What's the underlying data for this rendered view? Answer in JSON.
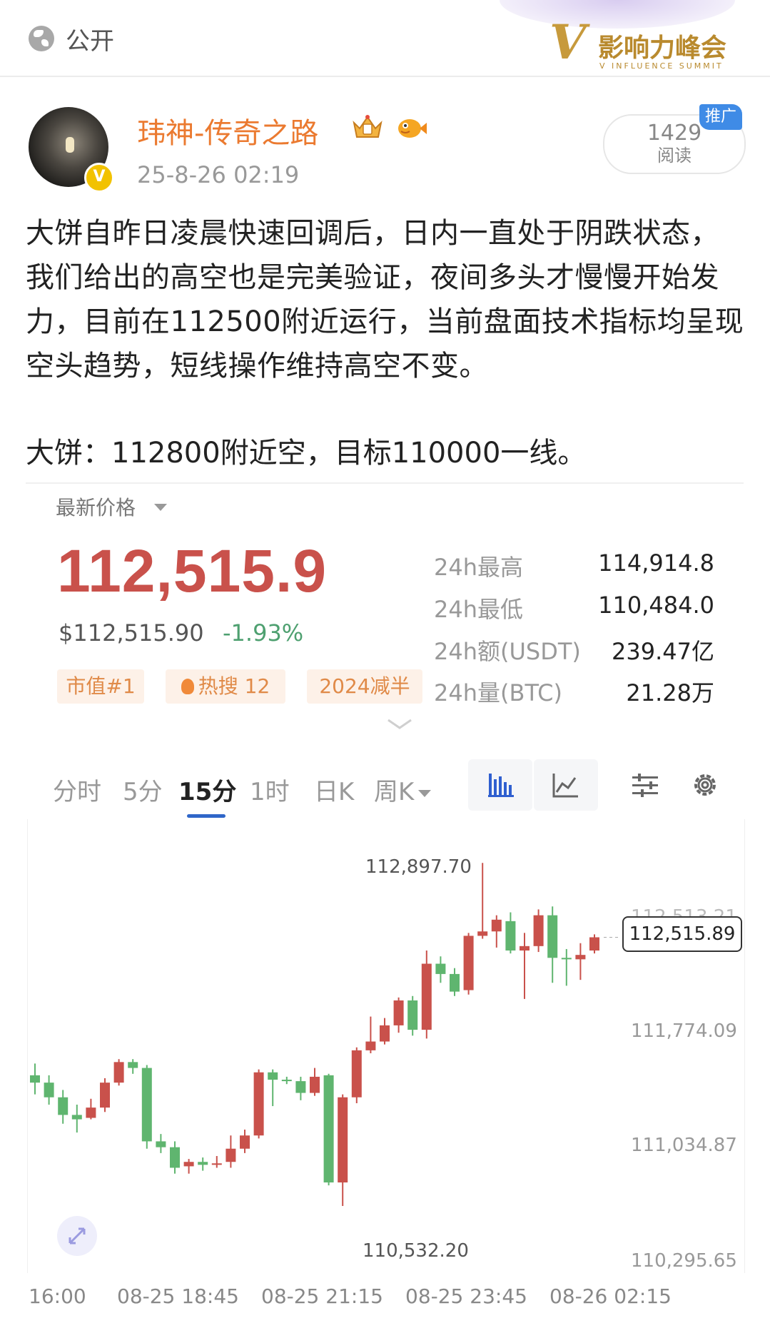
{
  "header": {
    "visibility_label": "公开",
    "brand_logo_text": "影响力峰会",
    "brand_logo_subtext": "V INFLUENCE SUMMIT"
  },
  "post": {
    "author_name": "玮神-传奇之路",
    "timestamp": "25-8-26 02:19",
    "verified_badge": "V",
    "read_count": "1429",
    "read_label": "阅读",
    "promo_tag": "推广",
    "paragraph_1": "大饼自昨日凌晨快速回调后，日内一直处于阴跌状态，我们给出的高空也是完美验证，夜间多头才慢慢开始发力，目前在112500附近运行，当前盘面技术指标均呈现空头趋势，短线操作维持高空不变。",
    "paragraph_2": "大饼：112800附近空，目标110000一线。"
  },
  "price_card": {
    "latest_label": "最新价格",
    "price": "112,515.9",
    "usd_price": "$112,515.90",
    "change_pct": "-1.93%",
    "change_color": "#4ea070",
    "price_color": "#c9514b",
    "tags": [
      "市值#1",
      "热搜 12",
      "2024减半"
    ],
    "stats": [
      {
        "label": "24h最高",
        "value": "114,914.8"
      },
      {
        "label": "24h最低",
        "value": "110,484.0"
      },
      {
        "label": "24h额(USDT)",
        "value": "239.47亿"
      },
      {
        "label": "24h量(BTC)",
        "value": "21.28万"
      }
    ]
  },
  "interval_tabs": {
    "items": [
      "分时",
      "5分",
      "15分",
      "1时",
      "日K",
      "周K"
    ],
    "selected": "15分",
    "tools": [
      "candlestick-icon",
      "line-chart-icon",
      "indicator-settings-icon",
      "gear-icon"
    ]
  },
  "chart_data": {
    "type": "candlestick",
    "x_ticks": [
      "16:00",
      "08-25 18:45",
      "08-25 21:15",
      "08-25 23:45",
      "08-26 02:15"
    ],
    "y_ticks": [
      111774.09,
      111034.87,
      110295.65
    ],
    "y_ticks_text": [
      "111,774.09",
      "111,034.87",
      "110,295.65"
    ],
    "ylim": [
      110200,
      113000
    ],
    "annotations": {
      "high": "112,897.70",
      "low": "110,532.20",
      "current": "112,515.89",
      "obscured_top_tick": "112,513.21"
    },
    "colors": {
      "up": "#c9514b",
      "down": "#5fb56f"
    },
    "candles": [
      {
        "o": 111450,
        "c": 111400,
        "h": 111530,
        "l": 111320
      },
      {
        "o": 111400,
        "c": 111300,
        "h": 111450,
        "l": 111250
      },
      {
        "o": 111300,
        "c": 111180,
        "h": 111350,
        "l": 111120
      },
      {
        "o": 111180,
        "c": 111150,
        "h": 111250,
        "l": 111060
      },
      {
        "o": 111160,
        "c": 111230,
        "h": 111290,
        "l": 111150
      },
      {
        "o": 111230,
        "c": 111400,
        "h": 111430,
        "l": 111200
      },
      {
        "o": 111400,
        "c": 111540,
        "h": 111560,
        "l": 111380
      },
      {
        "o": 111540,
        "c": 111500,
        "h": 111560,
        "l": 111460
      },
      {
        "o": 111500,
        "c": 111000,
        "h": 111520,
        "l": 110950
      },
      {
        "o": 111000,
        "c": 110960,
        "h": 111050,
        "l": 110920
      },
      {
        "o": 110960,
        "c": 110820,
        "h": 111000,
        "l": 110780
      },
      {
        "o": 110830,
        "c": 110860,
        "h": 110880,
        "l": 110780
      },
      {
        "o": 110860,
        "c": 110840,
        "h": 110890,
        "l": 110800
      },
      {
        "o": 110840,
        "c": 110850,
        "h": 110900,
        "l": 110820
      },
      {
        "o": 110860,
        "c": 110950,
        "h": 111040,
        "l": 110820
      },
      {
        "o": 110950,
        "c": 111040,
        "h": 111080,
        "l": 110920
      },
      {
        "o": 111040,
        "c": 111470,
        "h": 111490,
        "l": 111020
      },
      {
        "o": 111470,
        "c": 111420,
        "h": 111490,
        "l": 111240
      },
      {
        "o": 111420,
        "c": 111410,
        "h": 111440,
        "l": 111390
      },
      {
        "o": 111410,
        "c": 111330,
        "h": 111440,
        "l": 111280
      },
      {
        "o": 111330,
        "c": 111440,
        "h": 111500,
        "l": 111310
      },
      {
        "o": 111450,
        "c": 110720,
        "h": 111460,
        "l": 110700
      },
      {
        "o": 110720,
        "c": 111300,
        "h": 111320,
        "l": 110560
      },
      {
        "o": 111300,
        "c": 111620,
        "h": 111640,
        "l": 111260
      },
      {
        "o": 111620,
        "c": 111680,
        "h": 111850,
        "l": 111600
      },
      {
        "o": 111680,
        "c": 111790,
        "h": 111840,
        "l": 111660
      },
      {
        "o": 111790,
        "c": 111960,
        "h": 111980,
        "l": 111740
      },
      {
        "o": 111960,
        "c": 111760,
        "h": 111990,
        "l": 111720
      },
      {
        "o": 111760,
        "c": 112210,
        "h": 112300,
        "l": 111700
      },
      {
        "o": 112210,
        "c": 112140,
        "h": 112260,
        "l": 112080
      },
      {
        "o": 112140,
        "c": 112020,
        "h": 112180,
        "l": 111990
      },
      {
        "o": 112030,
        "c": 112400,
        "h": 112420,
        "l": 112000
      },
      {
        "o": 112400,
        "c": 112430,
        "h": 112897,
        "l": 112380
      },
      {
        "o": 112430,
        "c": 112510,
        "h": 112540,
        "l": 112320
      },
      {
        "o": 112500,
        "c": 112300,
        "h": 112560,
        "l": 112280
      },
      {
        "o": 112300,
        "c": 112330,
        "h": 112420,
        "l": 111970
      },
      {
        "o": 112330,
        "c": 112540,
        "h": 112580,
        "l": 112290
      },
      {
        "o": 112540,
        "c": 112250,
        "h": 112600,
        "l": 112080
      },
      {
        "o": 112250,
        "c": 112240,
        "h": 112310,
        "l": 112060
      },
      {
        "o": 112240,
        "c": 112270,
        "h": 112350,
        "l": 112100
      },
      {
        "o": 112300,
        "c": 112390,
        "h": 112410,
        "l": 112280
      }
    ]
  }
}
